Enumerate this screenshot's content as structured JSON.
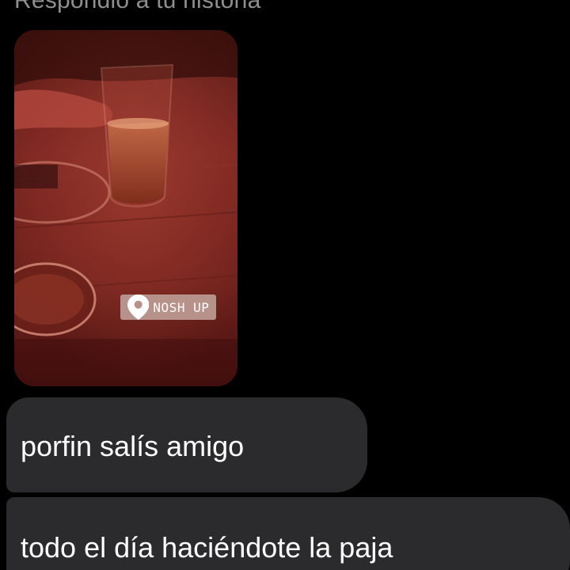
{
  "conversation": {
    "reply_caption": "Respondió a tu historia"
  },
  "story": {
    "location_sticker": "NOSH UP",
    "location_icon": "map-pin-icon",
    "tint_color": "#8e2a22"
  },
  "messages": [
    {
      "text": "porfin salís amigo"
    },
    {
      "text": "todo el día haciéndote la paja"
    }
  ],
  "colors": {
    "background": "#000000",
    "bubble": "#2b2b2d",
    "caption": "#8f8f8f",
    "message_text": "#ffffff"
  }
}
